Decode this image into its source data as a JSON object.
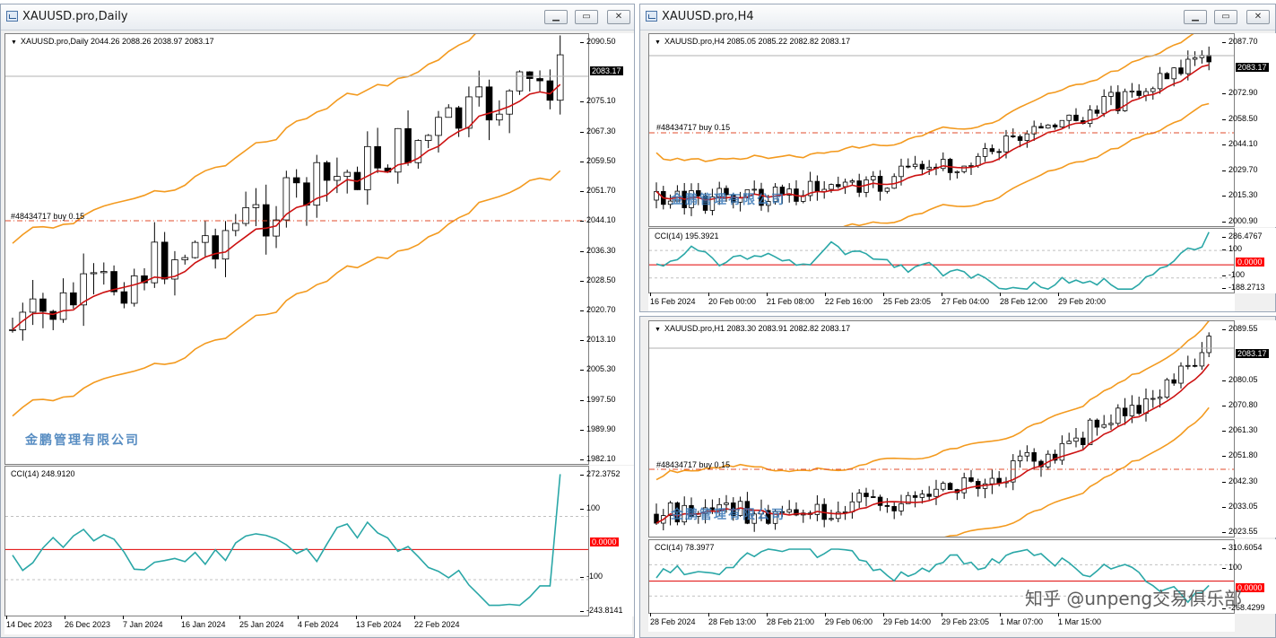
{
  "windows": [
    {
      "title": "XAUUSD.pro,Daily",
      "info": "XAUUSD.pro,Daily  2044.26 2088.26 2038.97 2083.17",
      "price_ticks": [
        "2090.50",
        "2083.17",
        "2075.10",
        "2067.30",
        "2059.50",
        "2051.70",
        "2044.10",
        "2036.30",
        "2028.50",
        "2020.70",
        "2013.10",
        "2005.30",
        "1997.50",
        "1989.90",
        "1982.10"
      ],
      "price_tag": "2083.17",
      "order_label": "#48434717 buy 0.15",
      "watermark": "金鹏管理有限公司",
      "cci_label": "CCI(14) 248.9120",
      "cci_ticks": [
        "272.3752",
        "100",
        "0.0000",
        "-100",
        "-243.8141"
      ],
      "cci_zero_tag": "0.0000",
      "dates": [
        "14 Dec 2023",
        "26 Dec 2023",
        "7 Jan 2024",
        "16 Jan 2024",
        "25 Jan 2024",
        "4 Feb 2024",
        "13 Feb 2024",
        "22 Feb 2024"
      ]
    },
    {
      "title": "XAUUSD.pro,H4",
      "info": "XAUUSD.pro,H4  2085.05 2085.22 2082.82 2083.17",
      "price_ticks": [
        "2087.70",
        "2083.17",
        "2072.90",
        "2058.50",
        "2044.10",
        "2029.70",
        "2015.30",
        "2000.90"
      ],
      "price_tag": "2083.17",
      "order_label": "#48434717 buy 0.15",
      "watermark": "金鹏管理有限公司",
      "cci_label": "CCI(14) 195.3921",
      "cci_ticks": [
        "286.4767",
        "100",
        "0.0000",
        "-100",
        "-188.2713"
      ],
      "cci_zero_tag": "0.0000",
      "dates": [
        "16 Feb 2024",
        "20 Feb 00:00",
        "21 Feb 08:00",
        "22 Feb 16:00",
        "25 Feb 23:05",
        "27 Feb 04:00",
        "28 Feb 12:00",
        "29 Feb 20:00"
      ]
    },
    {
      "title": "",
      "info": "XAUUSD.pro,H1  2083.30 2083.91 2082.82 2083.17",
      "price_ticks": [
        "2089.55",
        "2083.17",
        "2080.05",
        "2070.80",
        "2061.30",
        "2051.80",
        "2042.30",
        "2033.05",
        "2023.55"
      ],
      "price_tag": "2083.17",
      "order_label": "#48434717 buy 0.15",
      "watermark": "金鹏管理有限公司",
      "cci_label": "CCI(14) 78.3977",
      "cci_ticks": [
        "310.6054",
        "100",
        "0.0000",
        "-268.4299"
      ],
      "cci_zero_tag": "0.0000",
      "dates": [
        "28 Feb 2024",
        "28 Feb 13:00",
        "28 Feb 21:00",
        "29 Feb 06:00",
        "29 Feb 14:00",
        "29 Feb 23:05",
        "1 Mar 07:00",
        "1 Mar 15:00"
      ]
    }
  ],
  "credit": "知乎 @unpeng交易俱乐部",
  "colors": {
    "band": "#f39a1f",
    "ma": "#cc1111",
    "cci": "#2aa7a7",
    "order": "#8b6a00",
    "order_dash": "#e04b2b",
    "zero": "#e00000"
  }
}
